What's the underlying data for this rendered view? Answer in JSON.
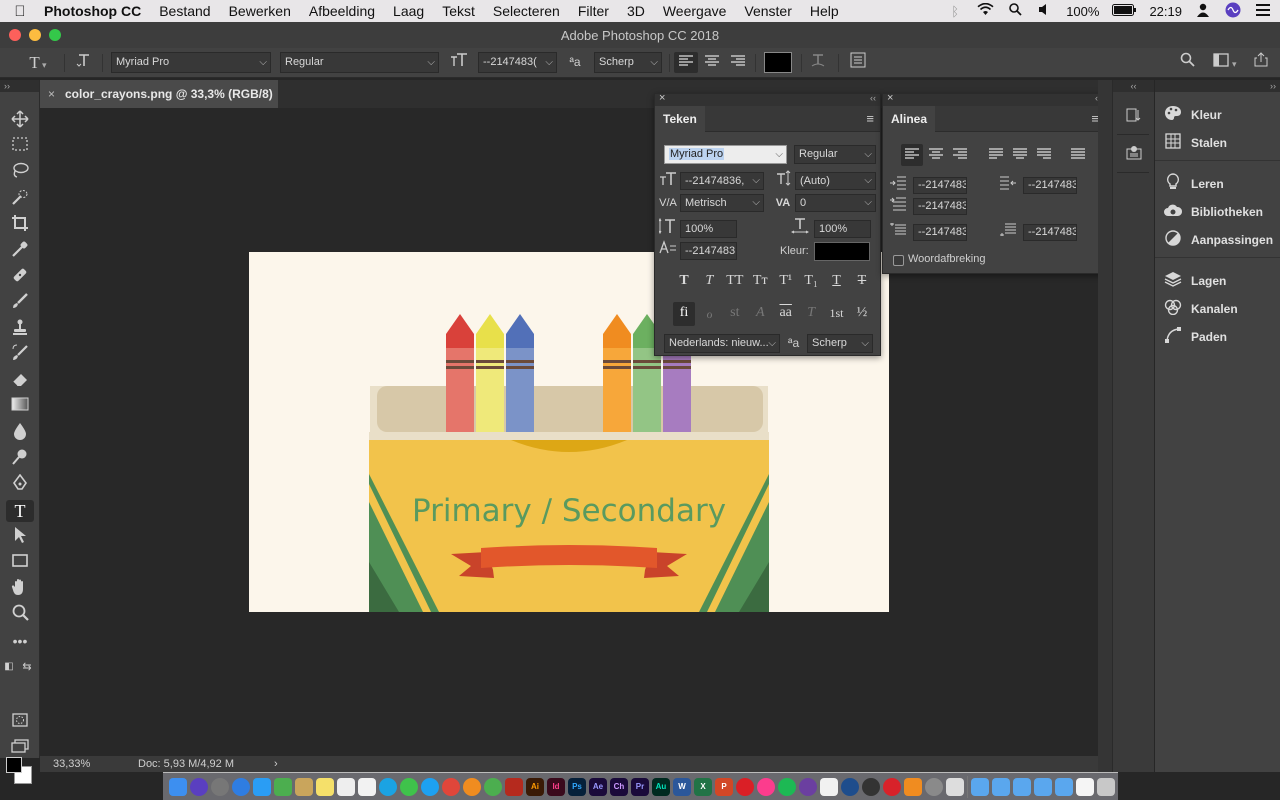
{
  "menubar": {
    "apple": "",
    "items": [
      "Photoshop CC",
      "Bestand",
      "Bewerken",
      "Afbeelding",
      "Laag",
      "Tekst",
      "Selecteren",
      "Filter",
      "3D",
      "Weergave",
      "Venster",
      "Help"
    ],
    "battery": "100%",
    "time": "22:19"
  },
  "window": {
    "title": "Adobe Photoshop CC 2018"
  },
  "options": {
    "tool_icon": "T",
    "font_family": "Myriad Pro",
    "font_style": "Regular",
    "font_size": "--2147483(",
    "aa_label": "ªa",
    "antialias": "Scherp"
  },
  "document": {
    "tab_label": "color_crayons.png @ 33,3% (RGB/8)",
    "close": "×",
    "artwork_text": "Primary / Secondary",
    "artwork_colors": {
      "bg": "#fcf6eb",
      "box": "#f2c34b",
      "stripe": "#4f8f55",
      "ribbon": "#e2572b",
      "text": "#5a9a5f"
    }
  },
  "status": {
    "zoom": "33,33%",
    "doc": "Doc: 5,93 M/4,92 M",
    "arrow": "›"
  },
  "teken": {
    "title": "Teken",
    "font_family": "Myriad Pro",
    "font_style": "Regular",
    "size": "--21474836,",
    "leading": "(Auto)",
    "kerning": "Metrisch",
    "tracking": "0",
    "vscale": "100%",
    "hscale": "100%",
    "baseline": "--2147483",
    "color_label": "Kleur:",
    "language": "Nederlands: nieuw...",
    "aa_label": "ªa",
    "antialias": "Scherp",
    "style_buttons": [
      "T",
      "T",
      "TT",
      "Tт",
      "T¹",
      "T₁",
      "T",
      "T"
    ],
    "opentype_buttons": [
      "fi",
      "ℴ",
      "st",
      "A",
      "aa",
      "T",
      "1st",
      "½"
    ]
  },
  "alinea": {
    "title": "Alinea",
    "indent_left": "--2147483",
    "indent_right": "--2147483",
    "first_line": "--2147483",
    "space_before": "--2147483",
    "space_after": "--2147483",
    "hyphenate_label": "Woordafbreking"
  },
  "panels": [
    {
      "label": "Kleur",
      "icon": "color-wheel-icon"
    },
    {
      "label": "Stalen",
      "icon": "swatches-icon"
    },
    {
      "label": "Leren",
      "icon": "learn-icon"
    },
    {
      "label": "Bibliotheken",
      "icon": "libraries-icon"
    },
    {
      "label": "Aanpassingen",
      "icon": "adjustments-icon"
    },
    {
      "label": "Lagen",
      "icon": "layers-icon"
    },
    {
      "label": "Kanalen",
      "icon": "channels-icon"
    },
    {
      "label": "Paden",
      "icon": "paths-icon"
    }
  ]
}
